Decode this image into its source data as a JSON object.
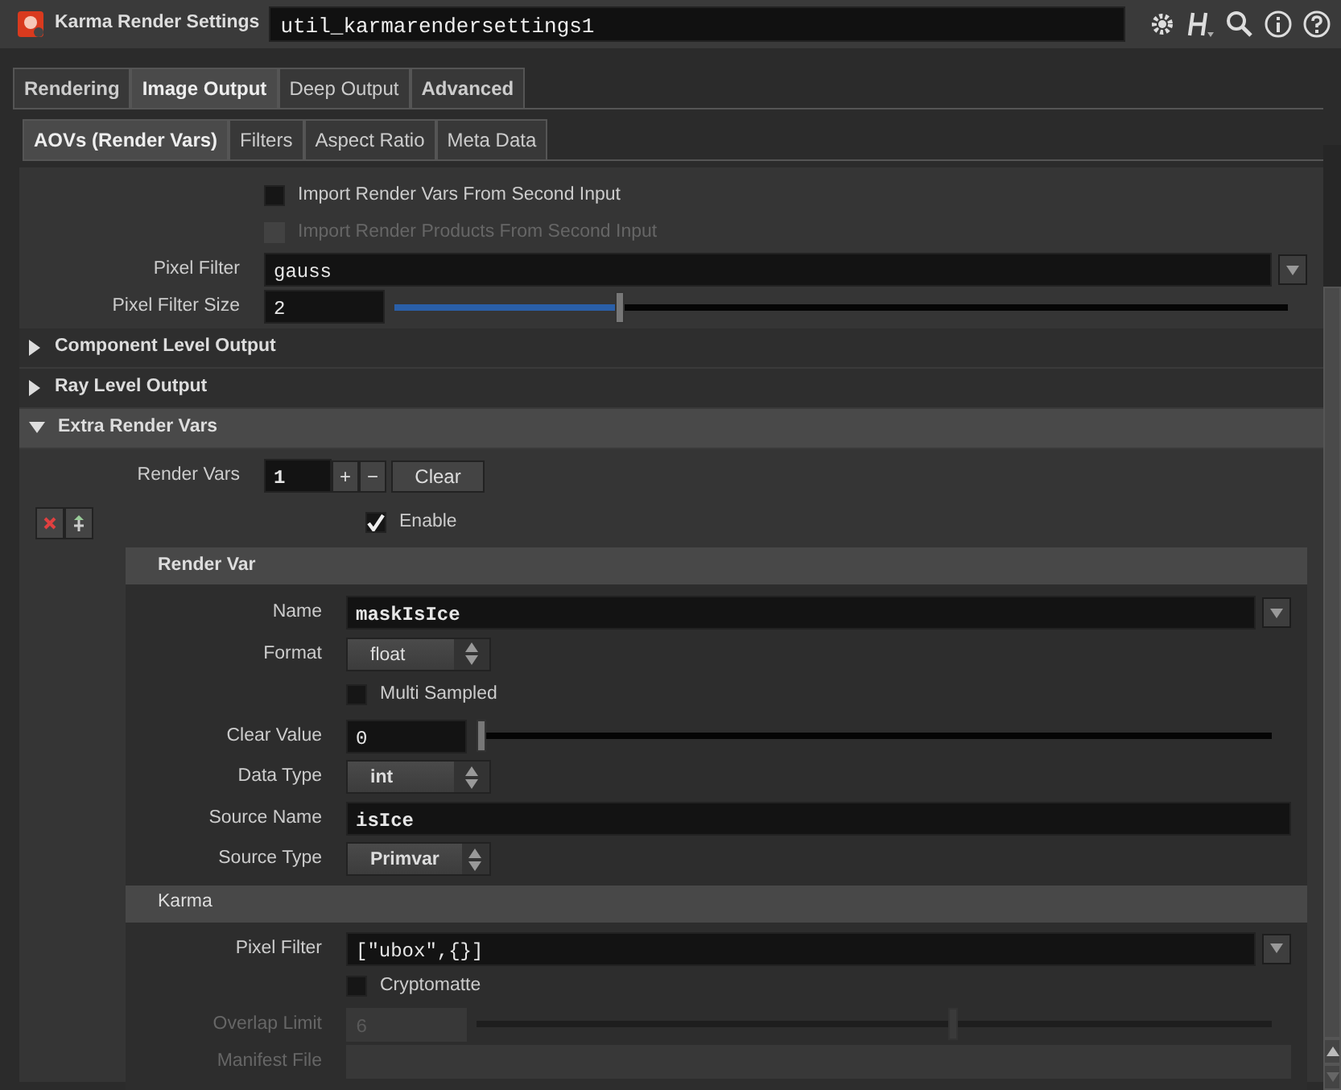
{
  "header": {
    "node_type": "Karma Render Settings",
    "node_name": "util_karmarendersettings1"
  },
  "tabs": [
    {
      "label": "Rendering",
      "selected": false,
      "modified": true
    },
    {
      "label": "Image Output",
      "selected": true,
      "modified": true
    },
    {
      "label": "Deep Output",
      "selected": false,
      "modified": false
    },
    {
      "label": "Advanced",
      "selected": false,
      "modified": true
    }
  ],
  "subtabs": [
    {
      "label": "AOVs (Render Vars)",
      "selected": true,
      "modified": true
    },
    {
      "label": "Filters",
      "selected": false,
      "modified": false
    },
    {
      "label": "Aspect Ratio",
      "selected": false,
      "modified": false
    },
    {
      "label": "Meta Data",
      "selected": false,
      "modified": false
    }
  ],
  "top_params": [
    {
      "kind": "checkbox",
      "label": "Import Render Vars From Second Input",
      "checked": false,
      "disabled": false
    },
    {
      "kind": "checkbox",
      "label": "Import Render Products From Second Input",
      "checked": false,
      "disabled": true
    },
    {
      "kind": "menu-field",
      "label": "Pixel Filter",
      "value": "gauss",
      "modified": false,
      "disabled": false
    },
    {
      "kind": "slider",
      "label": "Pixel Filter Size",
      "value": "2",
      "level": 0.25,
      "modified": false,
      "disabled": false
    }
  ],
  "sections": [
    {
      "title": "Component Level Output",
      "expanded": false
    },
    {
      "title": "Ray Level Output",
      "expanded": false
    },
    {
      "title": "Extra Render Vars",
      "expanded": true
    }
  ],
  "render_vars": {
    "label": "Render Vars",
    "count": "1",
    "add": "+",
    "remove": "−",
    "clear": "Clear",
    "enable": {
      "label": "Enable",
      "checked": true
    }
  },
  "render_var": {
    "title": "Render Var",
    "params": [
      {
        "kind": "menu-field",
        "label": "Name",
        "value": "maskIsIce",
        "modified": true,
        "disabled": false
      },
      {
        "kind": "select",
        "label": "Format",
        "value": "float",
        "modified": false,
        "disabled": false
      },
      {
        "kind": "checkbox",
        "label": "Multi Sampled",
        "checked": false,
        "disabled": false
      },
      {
        "kind": "slider",
        "label": "Clear Value",
        "value": "0",
        "level": 0,
        "modified": false,
        "disabled": false
      },
      {
        "kind": "select",
        "label": "Data Type",
        "value": "int",
        "modified": true,
        "disabled": false
      },
      {
        "kind": "text",
        "label": "Source Name",
        "value": "isIce",
        "modified": true,
        "disabled": false
      },
      {
        "kind": "select",
        "label": "Source Type",
        "value": "Primvar",
        "modified": true,
        "disabled": false
      }
    ]
  },
  "karma": {
    "title": "Karma",
    "params": [
      {
        "kind": "menu-field",
        "label": "Pixel Filter",
        "value": "[\"ubox\",{}]",
        "modified": false,
        "disabled": false
      },
      {
        "kind": "checkbox",
        "label": "Cryptomatte",
        "checked": false,
        "disabled": false
      },
      {
        "kind": "slider",
        "label": "Overlap Limit",
        "value": "6",
        "level": 0.6,
        "modified": false,
        "disabled": true
      },
      {
        "kind": "text",
        "label": "Manifest File",
        "modified": false,
        "disabled": true
      }
    ]
  }
}
